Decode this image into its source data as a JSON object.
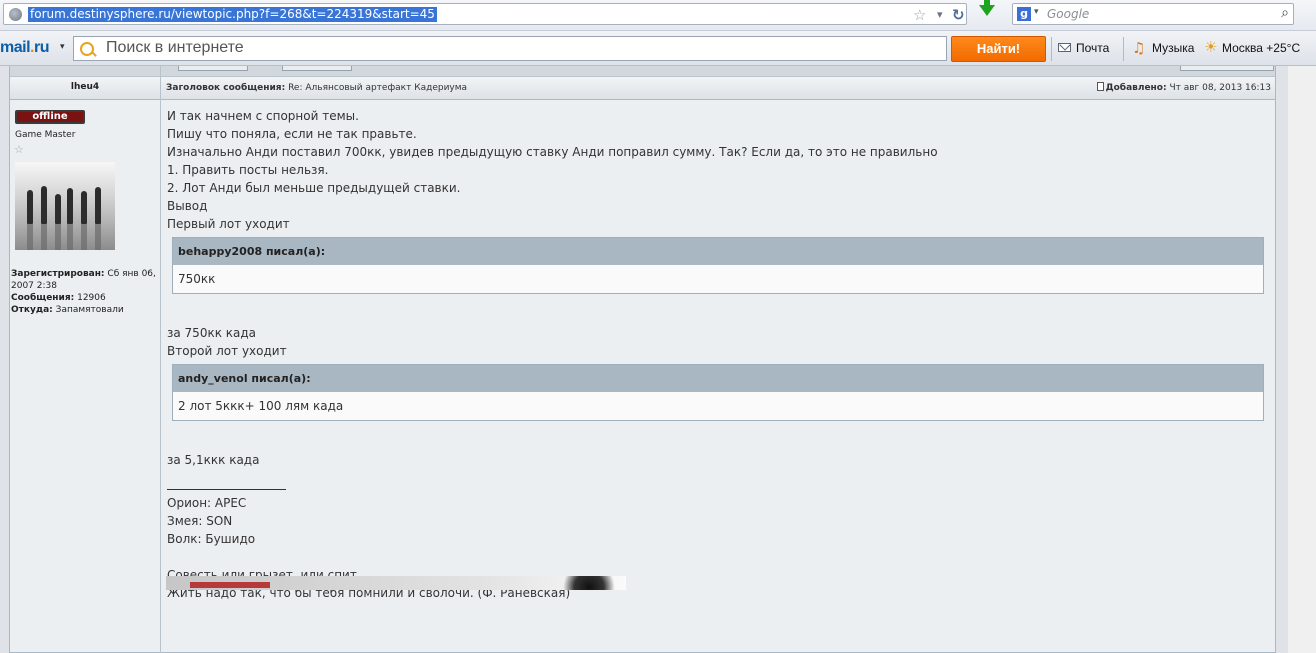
{
  "browser": {
    "url": "forum.destinysphere.ru/viewtopic.php?f=268&t=224319&start=45",
    "search_placeholder": "Google",
    "search_engine_icon": "g-icon"
  },
  "mailru_toolbar": {
    "logo_prefix": "mail",
    "logo_dot": ".",
    "logo_suffix": "ru",
    "search_placeholder": "Поиск в интернете",
    "find_button": "Найти!",
    "mail_label": "Почта",
    "music_label": "Музыка",
    "weather_label": "Москва +25°C",
    "accent_color": "#f26a00"
  },
  "post": {
    "author": "lheu4",
    "subject_label": "Заголовок сообщения:",
    "subject": "Re: Альянсовый артефакт Кадериума",
    "posted_label": "Добавлено:",
    "posted_time": "Чт авг 08, 2013 16:13",
    "status_badge": "offline",
    "rank": "Game Master",
    "profile": {
      "registered_label": "Зарегистрирован:",
      "registered": "Сб янв 06, 2007 2:38",
      "messages_label": "Сообщения:",
      "messages": "12906",
      "from_label": "Откуда:",
      "from": "Запамятовали"
    },
    "body_intro": [
      "И так начнем с спорной темы.",
      "Пишу что поняла, если не так правьте.",
      "Изначально Анди поставил 700кк, увидев предыдущую ставку Анди поправил сумму. Так? Если да, то это не правильно",
      "1. Править посты нельзя.",
      "2. Лот Анди был меньше предыдущей ставки.",
      "Вывод",
      "Первый лот уходит"
    ],
    "quote1": {
      "header": "behappy2008 писал(а):",
      "text": "750кк"
    },
    "body_middle": [
      "за 750кк када",
      "Второй лот уходит"
    ],
    "quote2": {
      "header": "andy_venol писал(а):",
      "text": "2 лот 5ккк+ 100 лям када"
    },
    "body_end": "за 5,1ккк када",
    "signature": [
      "Орион: APEC",
      "Змея: SON",
      "Волк: Бушидо"
    ],
    "quote_lines": [
      "Совесть или грызет, или спит.",
      "Жить надо так, что бы тебя помнили и сволочи. (Ф. Раневская)"
    ]
  }
}
